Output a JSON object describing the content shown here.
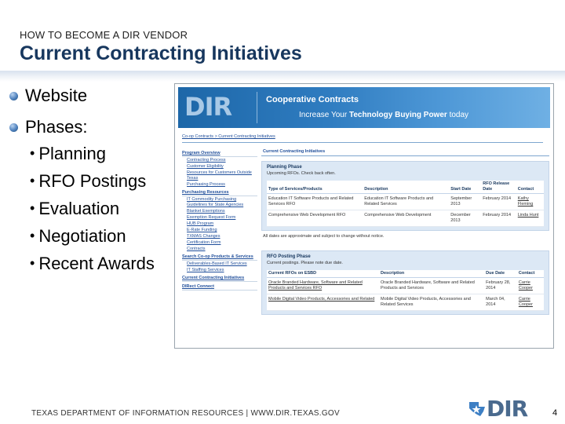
{
  "header": {
    "kicker": "HOW TO BECOME A DIR VENDOR",
    "title": "Current Contracting Initiatives"
  },
  "bullets": {
    "website": "Website",
    "phases": "Phases:",
    "sub": [
      "Planning",
      "RFO Postings",
      "Evaluation",
      "Negotiation",
      "Recent Awards"
    ]
  },
  "screenshot": {
    "logo": "DIR",
    "banner_title": "Cooperative Contracts",
    "banner_sub_pre": "Increase Your",
    "banner_sub_bold": "Technology Buying Power",
    "banner_sub_post": "today",
    "breadcrumb": "Co-op Contracts > Current Contracting Initiatives",
    "nav": [
      {
        "type": "hd",
        "label": "Program Overview"
      },
      {
        "type": "it",
        "label": "Contracting Process"
      },
      {
        "type": "it",
        "label": "Customer Eligibility"
      },
      {
        "type": "it",
        "label": "Resources for Customers Outside Texas"
      },
      {
        "type": "it",
        "label": "Purchasing Process"
      },
      {
        "type": "hd",
        "label": "Purchasing Resources"
      },
      {
        "type": "it",
        "label": "IT Commodity Purchasing Guidelines for State Agencies"
      },
      {
        "type": "it",
        "label": "Blanket Exemptions"
      },
      {
        "type": "it",
        "label": "Exemption Request Form"
      },
      {
        "type": "it",
        "label": "HUB Program"
      },
      {
        "type": "it",
        "label": "E-Rate Funding"
      },
      {
        "type": "it",
        "label": "TXMAS Changes"
      },
      {
        "type": "it",
        "label": "Certification Form"
      },
      {
        "type": "it",
        "label": "Contracts"
      },
      {
        "type": "hd",
        "label": "Search Co-op Products & Services"
      },
      {
        "type": "it",
        "label": "Deliverables-Based IT Services"
      },
      {
        "type": "it",
        "label": "IT Staffing Services"
      },
      {
        "type": "hd",
        "label": "Current Contracting Initiatives"
      },
      {
        "type": "hd",
        "label": "DIRect Connect"
      }
    ],
    "content_header": "Current Contracting Initiatives",
    "planning": {
      "title": "Planning Phase",
      "desc": "Upcoming RFOs. Check back often.",
      "columns": [
        "Type of Services/Products",
        "Description",
        "Start Date",
        "RFO Release Date",
        "Contact"
      ],
      "rows": [
        [
          "Education IT Software Products and Related Services RFO",
          "Education IT Software Products and Related Services",
          "September 2013",
          "February 2014",
          "Kathy Fleming"
        ],
        [
          "Comprehensive Web Development RFO",
          "Comprehensive Web Development",
          "December 2013",
          "February 2014",
          "Linda Hunt"
        ]
      ]
    },
    "note": "All dates are approximate and subject to change without notice.",
    "rfo": {
      "title": "RFO Posting Phase",
      "desc": "Current postings. Please note due date.",
      "columns": [
        "Current RFOs on ESBD",
        "Description",
        "Due Date",
        "Contact"
      ],
      "rows": [
        [
          "Oracle Branded Hardware, Software and Related Products and Services RFO",
          "Oracle Branded Hardware, Software and Related Products and Services",
          "February 28, 2014",
          "Carrie Cooper"
        ],
        [
          "Mobile Digital Video Products, Accessories and Related",
          "Mobile Digital Video Products, Accessories and Related Services",
          "March 04, 2014",
          "Carrie Cooper"
        ]
      ]
    }
  },
  "footer": {
    "text": "TEXAS DEPARTMENT OF INFORMATION RESOURCES | WWW.DIR.TEXAS.GOV",
    "logo": "DIR",
    "page": "4"
  },
  "colors": {
    "title": "#17375e",
    "accent": "#4f81bd",
    "banner": "#2f7cc0",
    "link": "#1f4e9a"
  }
}
